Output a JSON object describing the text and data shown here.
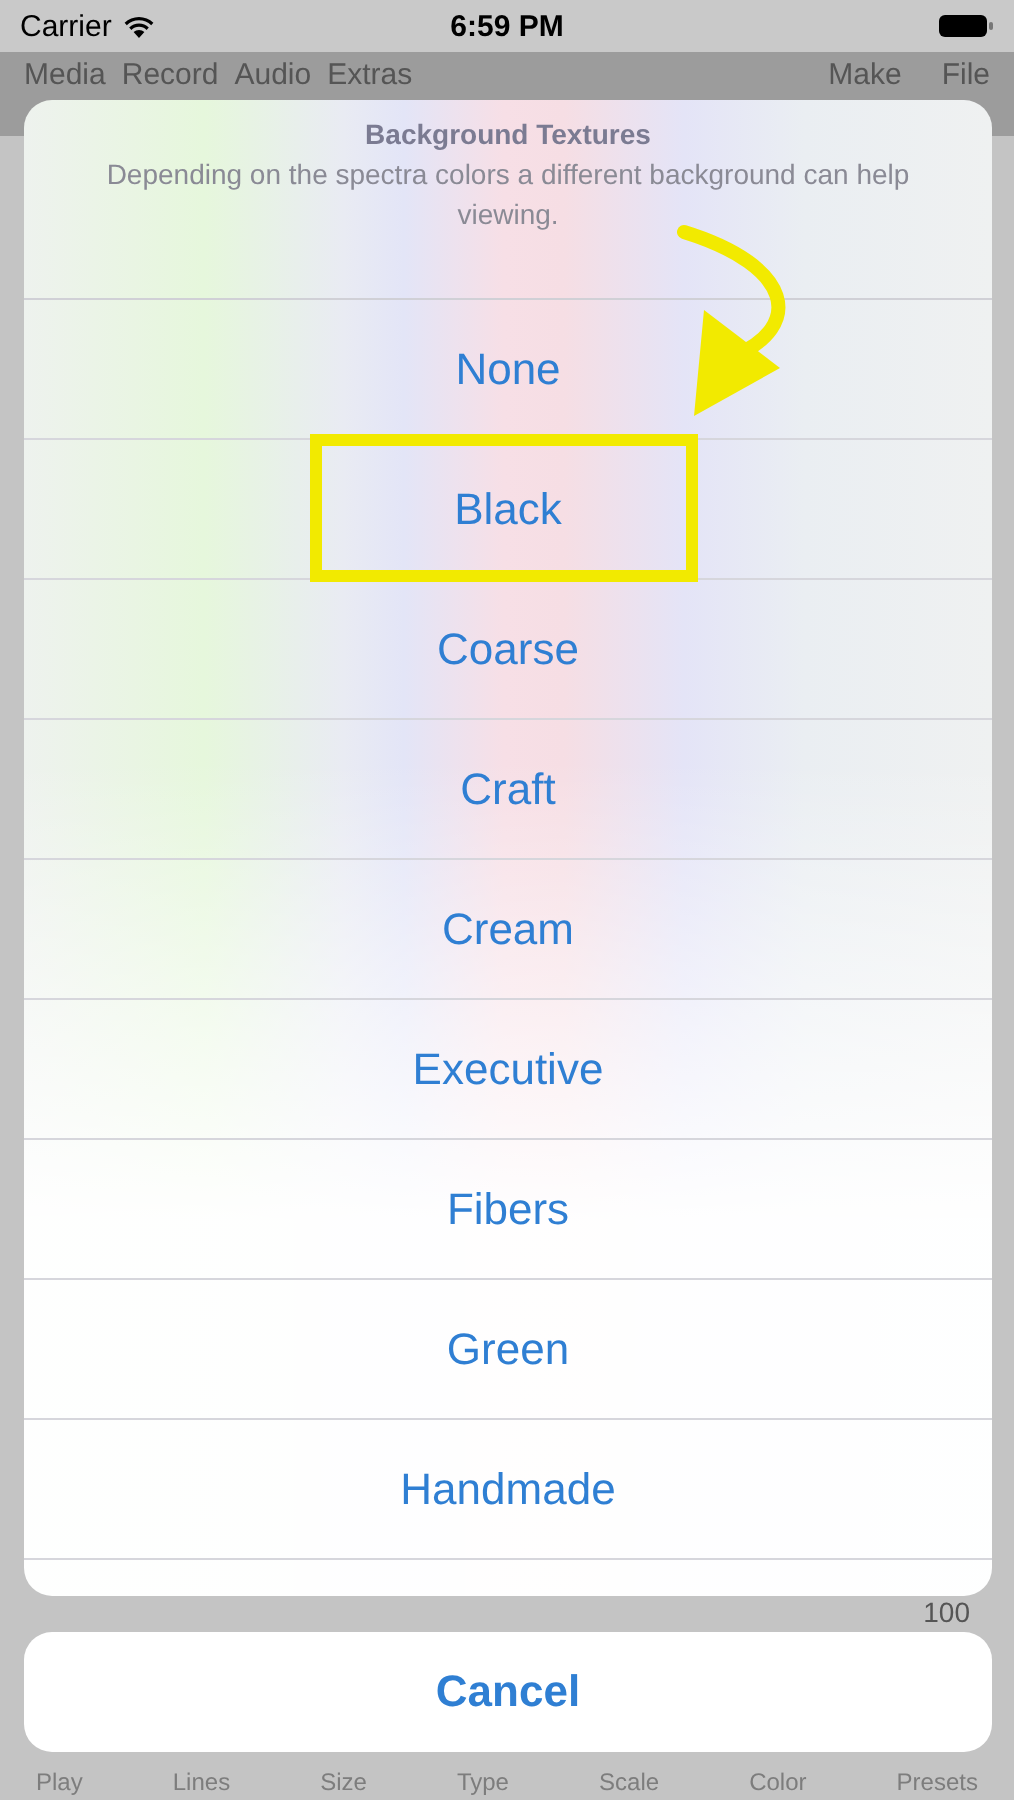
{
  "status_bar": {
    "carrier": "Carrier",
    "time": "6:59 PM"
  },
  "menu_bar": {
    "left": [
      "Media",
      "Record",
      "Audio",
      "Extras"
    ],
    "right": [
      "Make",
      "File"
    ]
  },
  "background_value": "100",
  "tab_bar": [
    "Play",
    "Lines",
    "Size",
    "Type",
    "Scale",
    "Color",
    "Presets"
  ],
  "action_sheet": {
    "title": "Background Textures",
    "message": "Depending on the spectra colors a different background can help viewing.",
    "options": [
      {
        "label": "None",
        "highlighted": false
      },
      {
        "label": "Black",
        "highlighted": true
      },
      {
        "label": "Coarse",
        "highlighted": false
      },
      {
        "label": "Craft",
        "highlighted": false
      },
      {
        "label": "Cream",
        "highlighted": false
      },
      {
        "label": "Executive",
        "highlighted": false
      },
      {
        "label": "Fibers",
        "highlighted": false
      },
      {
        "label": "Green",
        "highlighted": false
      },
      {
        "label": "Handmade",
        "highlighted": false
      }
    ],
    "cancel": "Cancel"
  }
}
